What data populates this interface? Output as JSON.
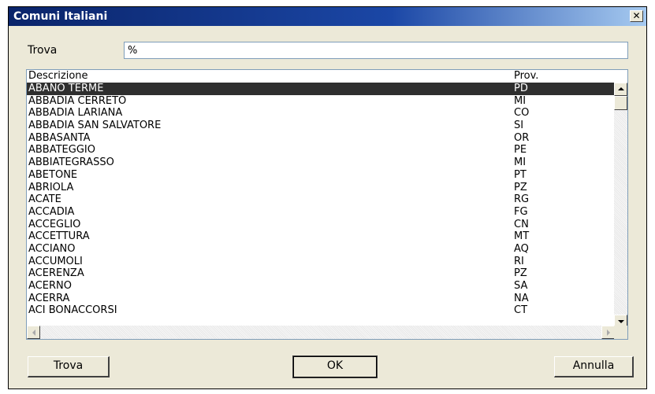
{
  "window": {
    "title": "Comuni Italiani",
    "close_label": "✕"
  },
  "search": {
    "label": "Trova",
    "value": "%"
  },
  "list": {
    "columns": [
      "Descrizione",
      "Prov."
    ],
    "rows": [
      [
        "ABANO TERME",
        "PD"
      ],
      [
        "ABBADIA CERRETO",
        "MI"
      ],
      [
        "ABBADIA LARIANA",
        "CO"
      ],
      [
        "ABBADIA SAN SALVATORE",
        "SI"
      ],
      [
        "ABBASANTA",
        "OR"
      ],
      [
        "ABBATEGGIO",
        "PE"
      ],
      [
        "ABBIATEGRASSO",
        "MI"
      ],
      [
        "ABETONE",
        "PT"
      ],
      [
        "ABRIOLA",
        "PZ"
      ],
      [
        "ACATE",
        "RG"
      ],
      [
        "ACCADIA",
        "FG"
      ],
      [
        "ACCEGLIO",
        "CN"
      ],
      [
        "ACCETTURA",
        "MT"
      ],
      [
        "ACCIANO",
        "AQ"
      ],
      [
        "ACCUMOLI",
        "RI"
      ],
      [
        "ACERENZA",
        "PZ"
      ],
      [
        "ACERNO",
        "SA"
      ],
      [
        "ACERRA",
        "NA"
      ],
      [
        "ACI BONACCORSI",
        "CT"
      ]
    ],
    "selected_index": 0
  },
  "buttons": {
    "trova": "Trova",
    "ok": "OK",
    "annulla": "Annulla"
  },
  "colors": {
    "titlebar": "#0a246a",
    "dialog_bg": "#ece9d8",
    "selection": "#2f2f2f"
  }
}
